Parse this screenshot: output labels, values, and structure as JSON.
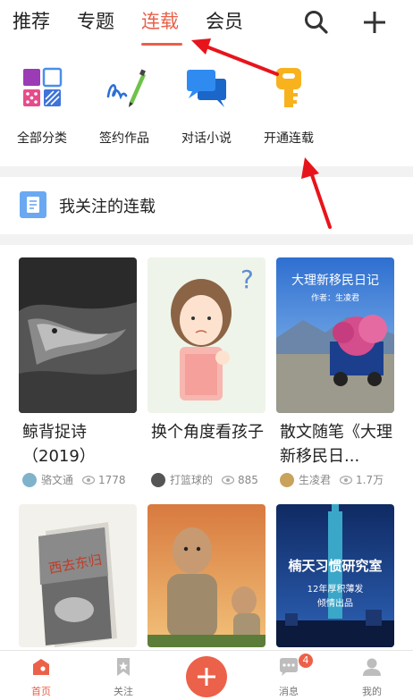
{
  "nav": {
    "tabs": [
      "推荐",
      "专题",
      "连载",
      "会员"
    ],
    "active_tab": "连载",
    "search_icon": "search-icon",
    "add_icon": "plus-icon",
    "accent": "#e9604a"
  },
  "categories": [
    {
      "label": "全部分类",
      "icon": "grid-icon"
    },
    {
      "label": "签约作品",
      "icon": "signature-pen-icon"
    },
    {
      "label": "对话小说",
      "icon": "chat-bubbles-icon"
    },
    {
      "label": "开通连载",
      "icon": "key-icon"
    }
  ],
  "follow_section": {
    "title": "我关注的连载",
    "icon": "document-icon"
  },
  "cards": [
    {
      "title": "鲸背捉诗（2019）",
      "author": "骆文通",
      "views": "1778"
    },
    {
      "title": "换个角度看孩子",
      "author": "打篮球的",
      "views": "885"
    },
    {
      "title": "散文随笔《大理新移民日...",
      "author": "生凌君",
      "views": "1.7万"
    }
  ],
  "covers": {
    "card3_title": "大理新移民日记",
    "card3_subtitle": "作者：生凌君",
    "card4_title": "西去东归",
    "card6_title": "楠天习惯研究室",
    "card6_subtitle1": "12年厚积薄发",
    "card6_subtitle2": "倾情出品"
  },
  "bottom_nav": [
    {
      "label": "首页",
      "icon": "home-icon",
      "active": true
    },
    {
      "label": "关注",
      "icon": "bookmark-icon",
      "active": false
    },
    {
      "label": "",
      "icon": "plus-icon",
      "active": false
    },
    {
      "label": "消息",
      "icon": "message-icon",
      "active": false,
      "badge": "4"
    },
    {
      "label": "我的",
      "icon": "user-icon",
      "active": false
    }
  ],
  "annotation_color": "#e8141b"
}
